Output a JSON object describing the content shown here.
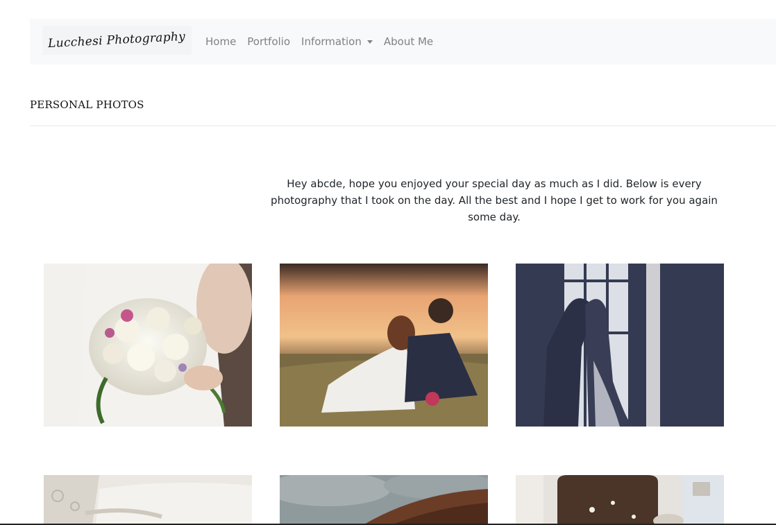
{
  "navbar": {
    "brand": "Lucchesi Photography",
    "links": [
      {
        "label": "Home"
      },
      {
        "label": "Portfolio"
      },
      {
        "label": "Information",
        "dropdown": true
      },
      {
        "label": "About Me"
      }
    ]
  },
  "page": {
    "title": "PERSONAL PHOTOS",
    "intro": "Hey abcde, hope you enjoyed your special day as much as I did. Below is every photography that I took on the day. All the best and I hope I get to work for you again some day."
  },
  "gallery": {
    "photos": [
      {
        "subject": "bride holding bouquet of white roses"
      },
      {
        "subject": "couple sitting by lake at sunset"
      },
      {
        "subject": "couple silhouette at window"
      },
      {
        "subject": "lace wedding dress detail"
      },
      {
        "subject": "cloudy sky over rocky hill"
      },
      {
        "subject": "couple at decorated archway"
      }
    ]
  },
  "colors": {
    "navbar_bg": "#f8f9fa",
    "nav_link": "#7c8389",
    "text": "#212529"
  }
}
